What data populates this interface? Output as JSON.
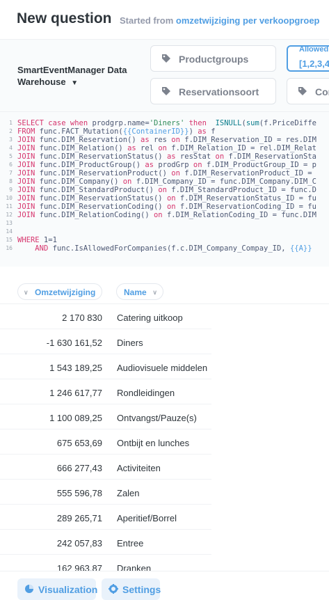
{
  "header": {
    "title": "New question",
    "subtitle_prefix": "Started from",
    "subtitle_link": "omzetwijziging per verkoopgroep"
  },
  "variables": {
    "database": "SmartEventManager Data Warehouse",
    "chips": [
      {
        "label": "Productgroups"
      },
      {
        "label": "Reservationsoort"
      },
      {
        "label": "Con"
      }
    ],
    "allowed": {
      "caption": "Allowed",
      "value": "[1,2,3,4"
    }
  },
  "editor": {
    "line_numbers": [
      "1",
      "2",
      "3",
      "4",
      "5",
      "6",
      "7",
      "8",
      "9",
      "10",
      "11",
      "12",
      "13",
      "14",
      "15",
      "16"
    ],
    "lines": [
      "SELECT case when prodgrp.name='Diners' then  ISNULL(sum(f.PriceDiffe",
      "FROM func.FACT_Mutation({{ContainerID}}) as f",
      "JOIN func.DIM_Reservation() as res on f.DIM_Reservation_ID = res.DIM",
      "JOIN func.DIM_Relation() as rel on f.DIM_Relation_ID = rel.DIM_Relat",
      "JOIN func.DIM_ReservationStatus() as resStat on f.DIM_ReservationSta",
      "JOIN func.DIM_ProductGroup() as prodGrp on f.DIM_ProductGroup_ID = p",
      "JOIN func.DIM_ReservationProduct() on f.DIM_ReservationProduct_ID =",
      "JOIN func.DIM_Company() on f.DIM_Company_ID = func.DIM_Company.DIM_C",
      "JOIN func.DIM_StandardProduct() on f.DIM_StandardProduct_ID = func.D",
      "JOIN func.DIM_ReservationStatus() on f.DIM_ReservationStatus_ID = fu",
      "JOIN func.DIM_ReservationCoding() on f.DIM_ReservationCoding_ID = fu",
      "JOIN func.DIM_RelationCoding() on f.DIM_RelationCoding_ID = func.DIM",
      "",
      "",
      "WHERE 1=1",
      "    AND func.IsAllowedForCompanies(f.c.DIM_Company_Compay_ID, {{A}}"
    ]
  },
  "table": {
    "columns": [
      "Omzetwijziging",
      "Name"
    ],
    "rows": [
      {
        "value": "2 170 830",
        "name": "Catering uitkoop"
      },
      {
        "value": "-1 630 161,52",
        "name": "Diners"
      },
      {
        "value": "1 543 189,25",
        "name": "Audiovisuele middelen"
      },
      {
        "value": "1 246 617,77",
        "name": "Rondleidingen"
      },
      {
        "value": "1 100 089,25",
        "name": "Ontvangst/Pauze(s)"
      },
      {
        "value": "675 653,69",
        "name": "Ontbijt en lunches"
      },
      {
        "value": "666 277,43",
        "name": "Activiteiten"
      },
      {
        "value": "555 596,78",
        "name": "Zalen"
      },
      {
        "value": "289 265,71",
        "name": "Aperitief/Borrel"
      },
      {
        "value": "242 057,83",
        "name": "Entree"
      },
      {
        "value": "162 963,87",
        "name": "Dranken"
      }
    ]
  },
  "footer": {
    "visualization_label": "Visualization",
    "settings_label": "Settings"
  },
  "icons": {
    "tag": "tag-icon",
    "chevron": "chevron-down-icon",
    "sort": "sort-arrow-icon",
    "visualization": "visualization-icon",
    "settings": "gear-icon"
  },
  "colors": {
    "accent": "#509ee3",
    "text": "#2e353b"
  }
}
